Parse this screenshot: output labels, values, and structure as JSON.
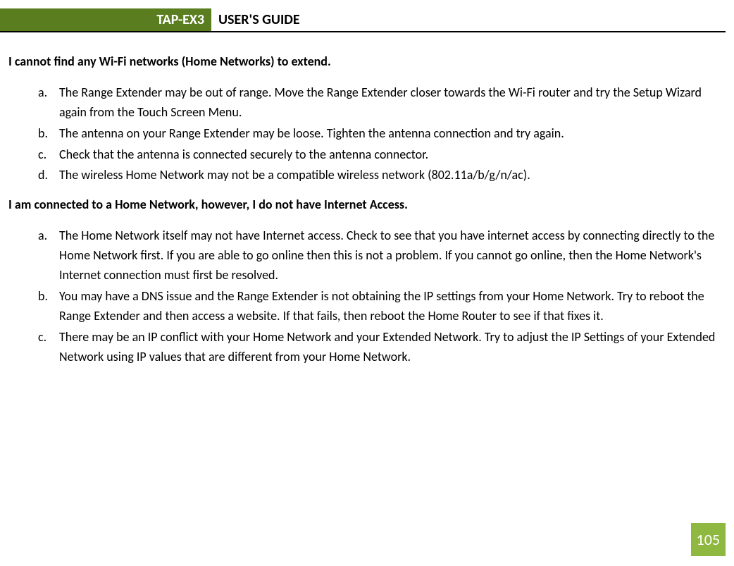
{
  "header": {
    "badge": "TAP-EX3",
    "title": "USER'S GUIDE"
  },
  "section1": {
    "heading": "I cannot find any Wi-Fi networks (Home Networks) to extend.",
    "items": {
      "a": "The Range Extender may be out of range. Move the Range Extender closer towards the Wi-Fi router and try the Setup Wizard again from the Touch Screen Menu.",
      "b": "The antenna on your Range Extender may be loose. Tighten the antenna connection and try again.",
      "c": "Check that the antenna is connected securely to the antenna connector.",
      "d": "The wireless Home Network may not be a compatible wireless network (802.11a/b/g/n/ac)."
    }
  },
  "section2": {
    "heading": "I am connected to a Home Network, however, I do not have Internet Access.",
    "items": {
      "a": "The Home Network itself may not have Internet access. Check to see that you have internet access by connecting directly to the Home Network first. If you are able to go online then this is not a problem. If you cannot go online, then the Home Network's Internet connection must first be resolved.",
      "b": "You may have a DNS issue and the Range Extender is not obtaining the IP settings from your Home Network. Try to reboot the Range Extender and then access a website. If that fails, then reboot the Home Router to see if that fixes it.",
      "c": "There may be an IP conflict with your Home Network and your Extended Network. Try to adjust the IP Settings of your Extended Network using IP values that are different from your Home Network."
    }
  },
  "markers": {
    "a": "a.",
    "b": "b.",
    "c": "c.",
    "d": "d."
  },
  "page_number": "105"
}
